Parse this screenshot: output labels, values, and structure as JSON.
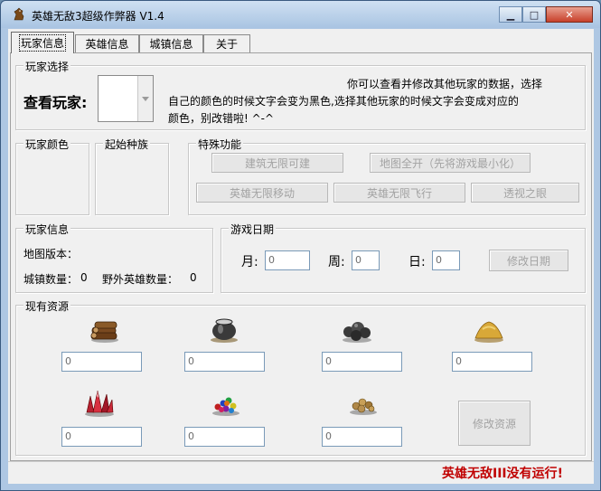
{
  "window": {
    "title": "英雄无敌3超级作弊器 V1.4",
    "min_glyph": "▁",
    "max_glyph": "□",
    "close_glyph": "✕"
  },
  "tabs": [
    {
      "label": "玩家信息",
      "active": true
    },
    {
      "label": "英雄信息",
      "active": false
    },
    {
      "label": "城镇信息",
      "active": false
    },
    {
      "label": "关于",
      "active": false
    }
  ],
  "player_select": {
    "group_label": "玩家选择",
    "view_label": "查看玩家:",
    "selected": "",
    "description": "你可以查看并修改其他玩家的数据，选择自己的颜色的时候文字会变为黑色,选择其他玩家的时候文字会变成对应的颜色，别改错啦! ^-^",
    "desc_line1": "你可以查看并修改其他玩家的数据，选择",
    "desc_line2": "自己的颜色的时候文字会变为黑色,选择其他玩家的时候文字会变成对应的",
    "desc_line3": "颜色，别改错啦! ^-^"
  },
  "player_color": {
    "group_label": "玩家颜色"
  },
  "start_race": {
    "group_label": "起始种族"
  },
  "special": {
    "group_label": "特殊功能",
    "buttons": [
      "建筑无限可建",
      "地图全开（先将游戏最小化）",
      "英雄无限移动",
      "英雄无限飞行",
      "透视之眼"
    ]
  },
  "player_info": {
    "group_label": "玩家信息",
    "map_version_label": "地图版本：",
    "town_count_label": "城镇数量：",
    "town_count": "0",
    "wild_hero_label": "野外英雄数量：",
    "wild_hero_count": "0"
  },
  "game_date": {
    "group_label": "游戏日期",
    "month_label": "月:",
    "month": "0",
    "week_label": "周:",
    "week": "0",
    "day_label": "日:",
    "day": "0",
    "modify_label": "修改日期"
  },
  "resources": {
    "group_label": "现有资源",
    "items": [
      {
        "icon": "wood-icon",
        "value": "0"
      },
      {
        "icon": "mercury-icon",
        "value": "0"
      },
      {
        "icon": "ore-icon",
        "value": "0"
      },
      {
        "icon": "sulfur-icon",
        "value": "0"
      },
      {
        "icon": "crystal-icon",
        "value": "0"
      },
      {
        "icon": "gems-icon",
        "value": "0"
      },
      {
        "icon": "gold-icon",
        "value": "0"
      }
    ],
    "modify_label": "修改资源"
  },
  "status": {
    "text": "英雄无敌III没有运行!"
  },
  "colors": {
    "status_red": "#c00000",
    "disabled_text": "#a3a3a3"
  }
}
